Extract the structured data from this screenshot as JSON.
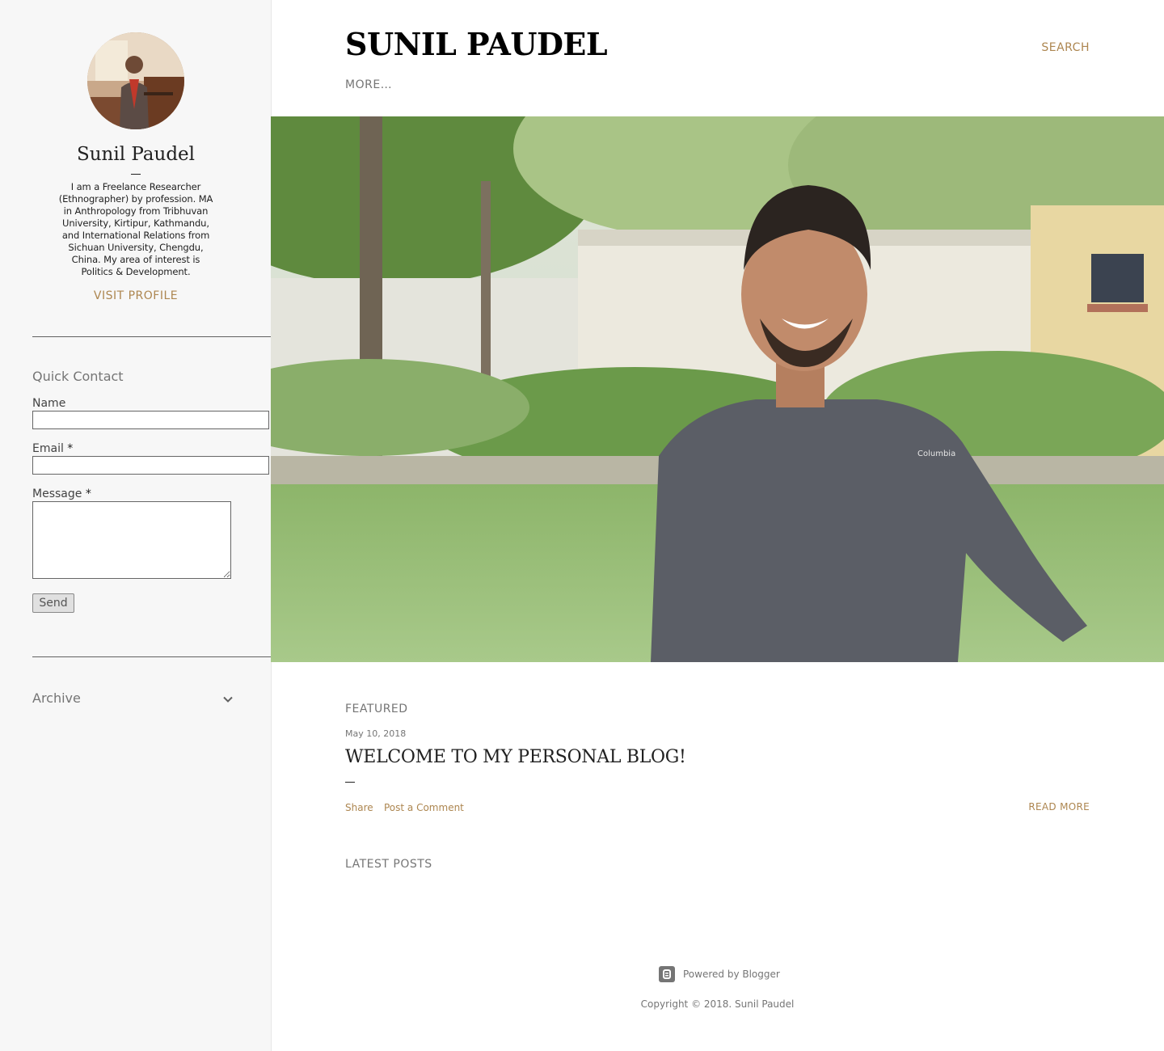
{
  "sidebar": {
    "profile_name": "Sunil Paudel",
    "profile_bio": "I am a Freelance Researcher (Ethnographer) by profession. MA in Anthropology from Tribhuvan University, Kirtipur, Kathmandu, and International Relations from Sichuan University, Chengdu, China. My area of interest is Politics & Development.",
    "visit_profile": "VISIT PROFILE",
    "quick_contact": {
      "title": "Quick Contact",
      "name_label": "Name",
      "email_label": "Email",
      "message_label": "Message",
      "required_mark": "*",
      "send_label": "Send"
    },
    "archive_label": "Archive"
  },
  "header": {
    "blog_title": "SUNIL PAUDEL",
    "search_label": "SEARCH",
    "more_label": "MORE…"
  },
  "featured": {
    "section_label": "FEATURED",
    "date": "May 10, 2018",
    "title": "WELCOME TO MY PERSONAL BLOG!",
    "share_label": "Share",
    "comment_label": "Post a Comment",
    "read_more_label": "READ MORE"
  },
  "latest": {
    "section_label": "LATEST POSTS"
  },
  "footer": {
    "powered_by": "Powered by Blogger",
    "copyright": "Copyright © 2018. Sunil Paudel"
  },
  "colors": {
    "accent": "#ad8650",
    "sidebar_bg": "#f7f7f7",
    "text_muted": "#757575"
  }
}
